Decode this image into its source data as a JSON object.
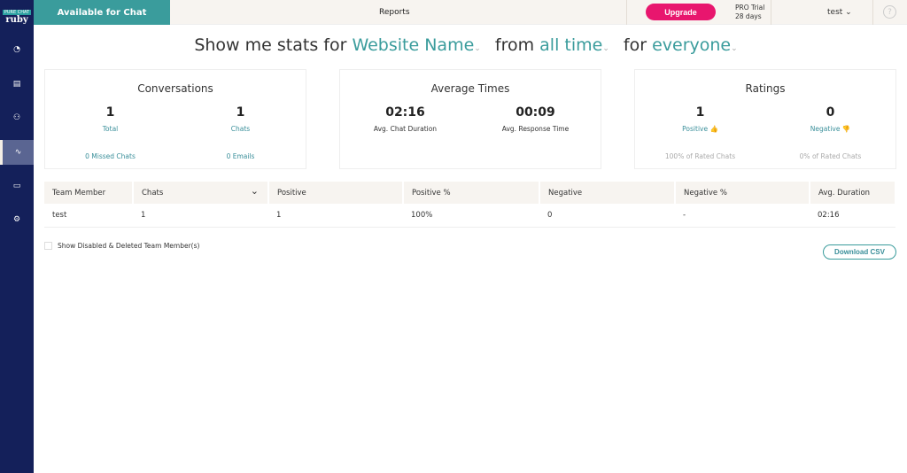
{
  "brand": {
    "small": "PURE CHAT",
    "name": "ruby"
  },
  "topbar": {
    "status": "Available for Chat",
    "title": "Reports",
    "upgrade": "Upgrade",
    "trial_line1": "PRO Trial",
    "trial_line2": "28 days",
    "user": "test",
    "help": "?"
  },
  "headline": {
    "p1": "Show me stats for",
    "site": "Website Name",
    "p2": "from",
    "range": "all time",
    "p3": "for",
    "who": "everyone"
  },
  "cards": {
    "conversations": {
      "title": "Conversations",
      "total": "1",
      "total_label": "Total",
      "chats": "1",
      "chats_label": "Chats",
      "missed": "0 Missed Chats",
      "emails": "0 Emails"
    },
    "times": {
      "title": "Average Times",
      "chat": "02:16",
      "chat_label": "Avg. Chat Duration",
      "resp": "00:09",
      "resp_label": "Avg. Response Time"
    },
    "ratings": {
      "title": "Ratings",
      "pos": "1",
      "pos_label": "Positive 👍",
      "neg": "0",
      "neg_label": "Negative 👎",
      "pos_pct": "100% of Rated Chats",
      "neg_pct": "0% of Rated Chats"
    }
  },
  "table": {
    "headers": [
      "Team Member",
      "Chats",
      "Positive",
      "Positive %",
      "Negative",
      "Negative %",
      "Avg. Duration"
    ],
    "rows": [
      [
        "test",
        "1",
        "1",
        "100%",
        "0",
        "-",
        "02:16"
      ]
    ]
  },
  "checkbox_label": "Show Disabled & Deleted Team Member(s)",
  "download": "Download CSV"
}
